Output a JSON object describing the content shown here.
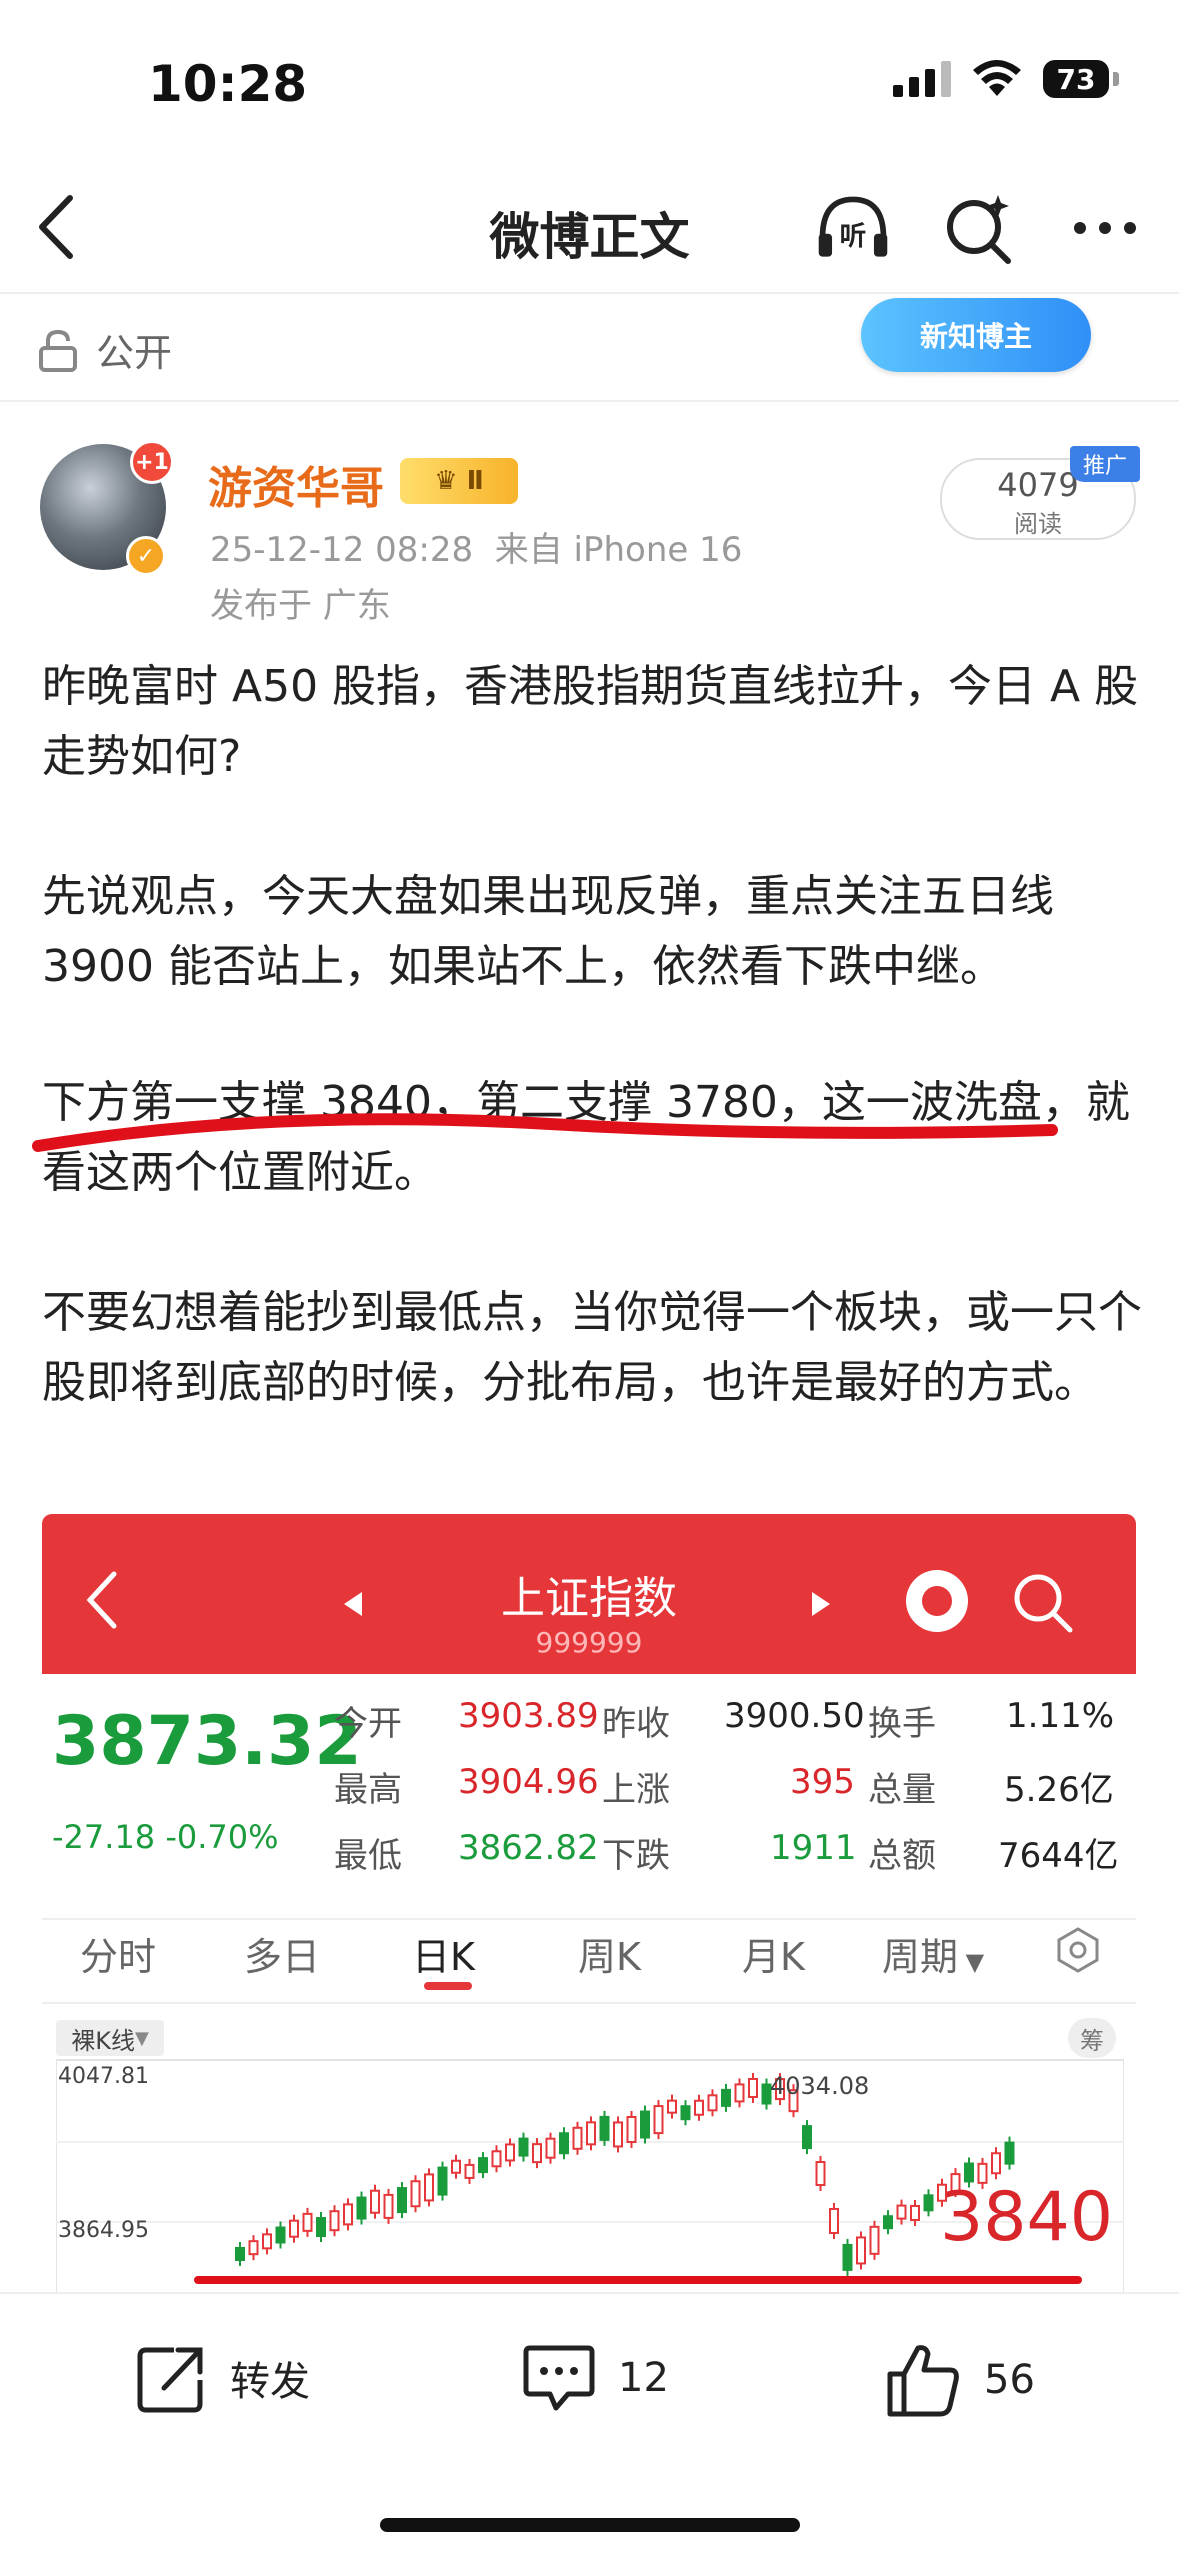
{
  "status": {
    "time": "10:28",
    "battery": "73"
  },
  "nav": {
    "title": "微博正文",
    "listen_icon": "听"
  },
  "privacy": {
    "label": "公开"
  },
  "badge": {
    "label": "新知博主"
  },
  "author": {
    "name": "游资华哥",
    "level": "Ⅱ",
    "plus": "+1",
    "timestamp": "25-12-12 08:28",
    "source": "来自 iPhone 16",
    "location": "发布于 广东",
    "reads": "4079",
    "reads_label": "阅读",
    "promo": "推广"
  },
  "post": {
    "p1": "昨晚富时 A50 股指，香港股指期货直线拉升，今日 A 股走势如何?",
    "p2": "先说观点，今天大盘如果出现反弹，重点关注五日线 3900 能否站上，如果站不上，依然看下跌中继。",
    "p3": "下方第一支撑 3840，第二支撑 3780，这一波洗盘，就看这两个位置附近。",
    "p4": "不要幻想着能抄到最低点，当你觉得一个板块，或一只个股即将到底部的时候，分批布局，也许是最好的方式。"
  },
  "stock": {
    "title": "上证指数",
    "code": "999999",
    "price": "3873.32",
    "change": "-27.18",
    "change_pct": "-0.70%",
    "rows": [
      {
        "l1": "今开",
        "v1": "3903.89",
        "l2": "昨收",
        "v2": "3900.50",
        "l3": "换手",
        "v3": "1.11%"
      },
      {
        "l1": "最高",
        "v1": "3904.96",
        "l2": "上涨",
        "v2": "395",
        "l3": "总量",
        "v3": "5.26亿"
      },
      {
        "l1": "最低",
        "v1": "3862.82",
        "l2": "下跌",
        "v2": "1911",
        "l3": "总额",
        "v3": "7644亿"
      }
    ],
    "tabs": [
      "分时",
      "多日",
      "日K",
      "周K",
      "月K",
      "周期"
    ],
    "kline_badge": "裸K线",
    "chou": "筹",
    "y_top": "4047.81",
    "y_mid": "3864.95",
    "peak_label": "4034.08",
    "support_label": "3840"
  },
  "actions": {
    "repost": "转发",
    "comments": "12",
    "likes": "56"
  },
  "colors": {
    "accent_red": "#e5363a",
    "price_green": "#1a9b3c",
    "name_orange": "#e86b19"
  }
}
